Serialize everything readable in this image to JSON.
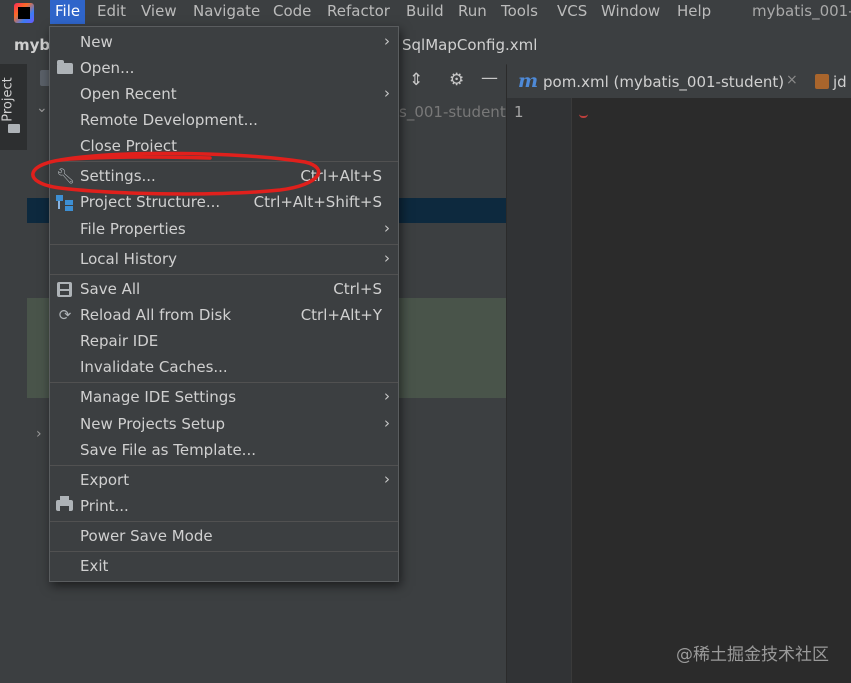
{
  "menubar": {
    "items": [
      "File",
      "Edit",
      "View",
      "Navigate",
      "Code",
      "Refactor",
      "Build",
      "Run",
      "Tools",
      "VCS",
      "Window",
      "Help"
    ],
    "active": "File",
    "window_title": "mybatis_001-"
  },
  "navbar": {
    "project": "myb",
    "file": "SqlMapConfig.xml"
  },
  "sidebar": {
    "project_tab": "Project"
  },
  "project_pane": {
    "title_tail": "s_001-student"
  },
  "editor": {
    "tabs": [
      {
        "label": "pom.xml (mybatis_001-student)",
        "close": "×"
      },
      {
        "label": "jd"
      }
    ],
    "line_number": "1"
  },
  "file_menu": {
    "new": "New",
    "open": "Open...",
    "open_recent": "Open Recent",
    "remote_development": "Remote Development...",
    "close_project": "Close Project",
    "settings": "Settings...",
    "settings_shortcut": "Ctrl+Alt+S",
    "project_structure": "Project Structure...",
    "project_structure_shortcut": "Ctrl+Alt+Shift+S",
    "file_properties": "File Properties",
    "local_history": "Local History",
    "save_all": "Save All",
    "save_all_shortcut": "Ctrl+S",
    "reload_all": "Reload All from Disk",
    "reload_all_shortcut": "Ctrl+Alt+Y",
    "repair_ide": "Repair IDE",
    "invalidate_caches": "Invalidate Caches...",
    "manage_ide_settings": "Manage IDE Settings",
    "new_projects_setup": "New Projects Setup",
    "save_as_template": "Save File as Template...",
    "export": "Export",
    "print": "Print...",
    "power_save": "Power Save Mode",
    "exit": "Exit"
  },
  "watermark": "@稀土掘金技术社区",
  "colors": {
    "menu_active": "#2f65ca",
    "annotation_red": "#e0201c",
    "menu_bg": "#3c3f41",
    "editor_bg": "#2b2b2b"
  }
}
